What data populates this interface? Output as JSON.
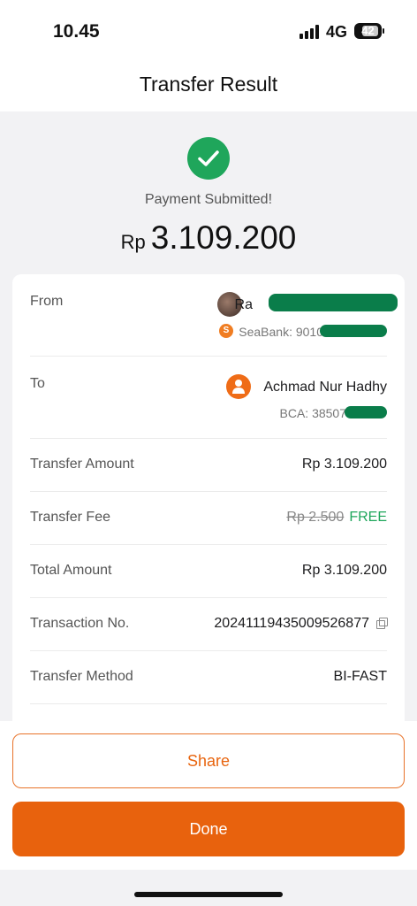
{
  "status_bar": {
    "time": "10.45",
    "network": "4G",
    "battery": "42"
  },
  "header": {
    "title": "Transfer Result"
  },
  "result": {
    "status": "Payment Submitted!",
    "currency": "Rp",
    "amount": "3.109.200",
    "status_color": "#1fa65b"
  },
  "details": {
    "from": {
      "label": "From",
      "name": "Ra",
      "bank": "SeaBank: 9010"
    },
    "to": {
      "label": "To",
      "name": "Achmad Nur Hadhy",
      "bank": "BCA: 38507"
    },
    "transfer_amount": {
      "label": "Transfer Amount",
      "value": "Rp 3.109.200"
    },
    "transfer_fee": {
      "label": "Transfer Fee",
      "old_value": "Rp 2.500",
      "value": "FREE"
    },
    "total_amount": {
      "label": "Total Amount",
      "value": "Rp 3.109.200"
    },
    "transaction_no": {
      "label": "Transaction No.",
      "value": "20241119435009526877"
    },
    "transfer_method": {
      "label": "Transfer Method",
      "value": "BI-FAST"
    }
  },
  "actions": {
    "share_label": "Share",
    "done_label": "Done",
    "accent_color": "#e8620d"
  },
  "icons": [
    "check-icon",
    "seabank-icon",
    "user-icon",
    "copy-icon",
    "signal-icon",
    "battery-icon"
  ]
}
